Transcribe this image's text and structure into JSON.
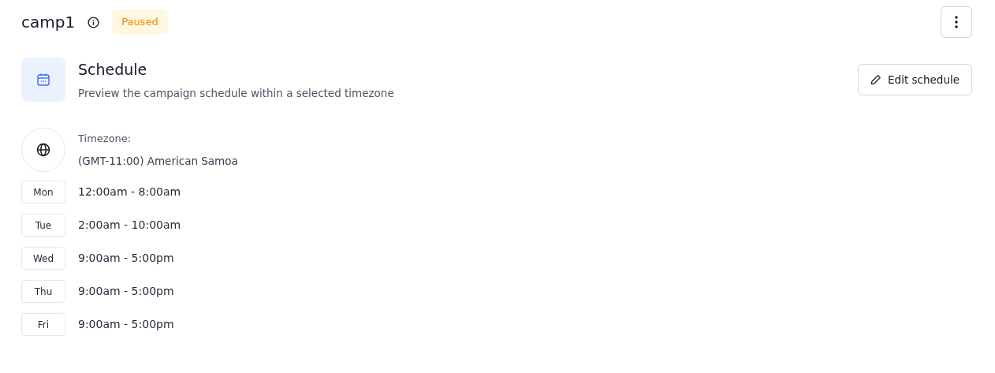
{
  "header": {
    "title": "camp1",
    "status": {
      "label": "Paused",
      "kind": "warning"
    }
  },
  "schedule": {
    "title": "Schedule",
    "subtitle": "Preview the campaign schedule within a selected timezone",
    "edit_button": "Edit schedule"
  },
  "timezone": {
    "label": "Timezone:",
    "value": "(GMT-11:00) American Samoa"
  },
  "days": [
    {
      "day": "Mon",
      "hours": "12:00am - 8:00am"
    },
    {
      "day": "Tue",
      "hours": "2:00am - 10:00am"
    },
    {
      "day": "Wed",
      "hours": "9:00am - 5:00pm"
    },
    {
      "day": "Thu",
      "hours": "9:00am - 5:00pm"
    },
    {
      "day": "Fri",
      "hours": "9:00am - 5:00pm"
    }
  ]
}
